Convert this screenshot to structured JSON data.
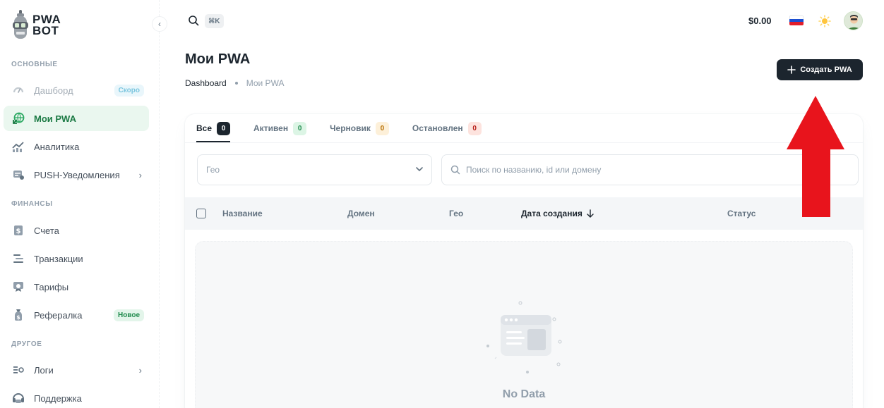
{
  "brand": {
    "line1": "PWA",
    "line2": "BOT"
  },
  "sidebar": {
    "sections": [
      {
        "title": "ОСНОВНЫЕ"
      },
      {
        "title": "ФИНАНСЫ"
      },
      {
        "title": "ДРУГОЕ"
      }
    ],
    "items": [
      {
        "label": "Дашборд",
        "badge": "Скоро",
        "icon": "gauge-icon",
        "state": "disabled"
      },
      {
        "label": "Мои PWA",
        "icon": "globe-app-icon",
        "state": "active"
      },
      {
        "label": "Аналитика",
        "icon": "analytics-icon"
      },
      {
        "label": "PUSH-Уведомления",
        "icon": "notification-icon",
        "has_submenu": true
      },
      {
        "label": "Счета",
        "icon": "invoice-icon"
      },
      {
        "label": "Транзакции",
        "icon": "transactions-icon"
      },
      {
        "label": "Тарифы",
        "icon": "tariffs-icon"
      },
      {
        "label": "Рефералка",
        "badge": "Новое",
        "icon": "referral-icon"
      },
      {
        "label": "Логи",
        "icon": "logs-icon",
        "has_submenu": true
      },
      {
        "label": "Поддержка",
        "icon": "support-icon"
      }
    ]
  },
  "header": {
    "search_shortcut": "⌘K",
    "balance": "$0.00",
    "language": "ru-flag-icon",
    "theme": "sun-icon"
  },
  "page": {
    "title": "Мои PWA",
    "breadcrumb": [
      "Dashboard",
      "Мои PWA"
    ],
    "create_button": "Создать PWA"
  },
  "tabs": [
    {
      "label": "Все",
      "count": "0"
    },
    {
      "label": "Активен",
      "count": "0"
    },
    {
      "label": "Черновик",
      "count": "0"
    },
    {
      "label": "Остановлен",
      "count": "0"
    }
  ],
  "filters": {
    "geo_placeholder": "Гео",
    "search_placeholder": "Поиск по названию, id или домену"
  },
  "table": {
    "columns": [
      "Название",
      "Домен",
      "Гео",
      "Дата создания",
      "Статус"
    ],
    "empty_text": "No Data"
  },
  "colors": {
    "primary_dark": "#1c252e",
    "active_green": "#1b7a44",
    "annotation_arrow": "#e8141c"
  }
}
